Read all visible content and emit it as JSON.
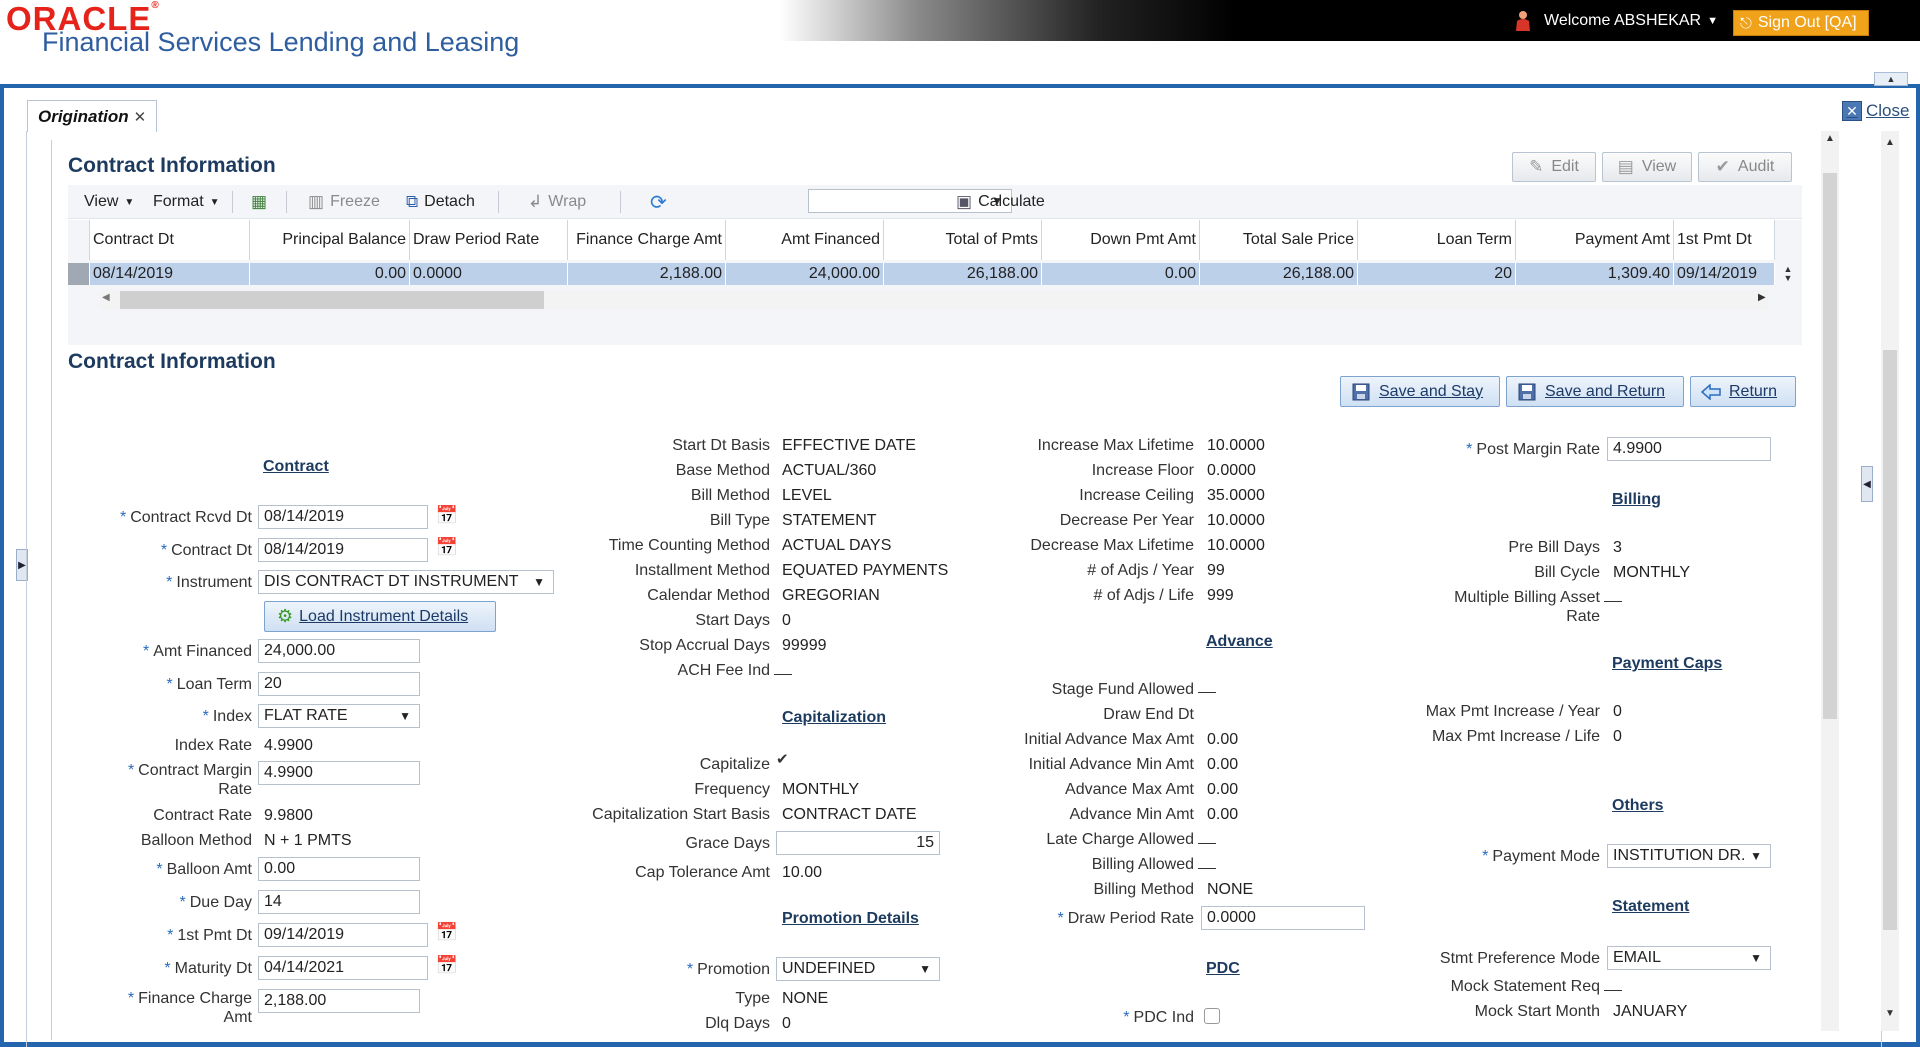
{
  "header": {
    "brand": "ORACLE",
    "product": "Financial Services Lending and Leasing",
    "welcome": "Welcome ABSHEKAR",
    "signout": "Sign Out [QA]"
  },
  "tabs": {
    "origination": "Origination",
    "close_label": "Close"
  },
  "section1": {
    "title": "Contract Information"
  },
  "top_buttons": {
    "edit": "Edit",
    "view": "View",
    "audit": "Audit"
  },
  "grid_toolbar": {
    "view": "View",
    "format": "Format",
    "freeze": "Freeze",
    "detach": "Detach",
    "wrap": "Wrap",
    "calculate": "Calculate"
  },
  "grid": {
    "columns": [
      "Contract Dt",
      "Principal Balance",
      "Draw Period Rate",
      "Finance Charge Amt",
      "Amt Financed",
      "Total of Pmts",
      "Down Pmt Amt",
      "Total Sale Price",
      "Loan Term",
      "Payment Amt",
      "1st Pmt Dt"
    ],
    "row": [
      "08/14/2019",
      "0.00",
      "0.0000",
      "2,188.00",
      "24,000.00",
      "26,188.00",
      "0.00",
      "26,188.00",
      "20",
      "1,309.40",
      "09/14/2019"
    ]
  },
  "section2": {
    "title": "Contract Information"
  },
  "actions": {
    "save_stay": "Save and Stay",
    "save_return": "Save and Return",
    "return": "Return"
  },
  "col1": {
    "group": "Contract",
    "contract_rcvd_dt_label": "Contract Rcvd Dt",
    "contract_rcvd_dt": "08/14/2019",
    "contract_dt_label": "Contract Dt",
    "contract_dt": "08/14/2019",
    "instrument_label": "Instrument",
    "instrument": "DIS CONTRACT DT INSTRUMENT",
    "load_instrument": "Load Instrument Details",
    "amt_financed_label": "Amt Financed",
    "amt_financed": "24,000.00",
    "loan_term_label": "Loan Term",
    "loan_term": "20",
    "index_label": "Index",
    "index": "FLAT RATE",
    "index_rate_label": "Index Rate",
    "index_rate": "4.9900",
    "contract_margin_label1": "Contract Margin",
    "contract_margin_label2": "Rate",
    "contract_margin": "4.9900",
    "contract_rate_label": "Contract Rate",
    "contract_rate": "9.9800",
    "balloon_method_label": "Balloon Method",
    "balloon_method": "N + 1 PMTS",
    "balloon_amt_label": "Balloon Amt",
    "balloon_amt": "0.00",
    "due_day_label": "Due Day",
    "due_day": "14",
    "first_pmt_dt_label": "1st Pmt Dt",
    "first_pmt_dt": "09/14/2019",
    "maturity_dt_label": "Maturity Dt",
    "maturity_dt": "04/14/2021",
    "finance_charge_label1": "Finance Charge",
    "finance_charge_label2": "Amt",
    "finance_charge": "2,188.00"
  },
  "col2": {
    "start_dt_basis_label": "Start Dt Basis",
    "start_dt_basis": "EFFECTIVE DATE",
    "base_method_label": "Base Method",
    "base_method": "ACTUAL/360",
    "bill_method_label": "Bill Method",
    "bill_method": "LEVEL",
    "bill_type_label": "Bill Type",
    "bill_type": "STATEMENT",
    "time_counting_label": "Time Counting Method",
    "time_counting": "ACTUAL DAYS",
    "installment_label": "Installment Method",
    "installment": "EQUATED PAYMENTS",
    "calendar_label": "Calendar Method",
    "calendar": "GREGORIAN",
    "start_days_label": "Start Days",
    "start_days": "0",
    "stop_accrual_label": "Stop Accrual Days",
    "stop_accrual": "99999",
    "ach_fee_label": "ACH Fee Ind",
    "cap_group": "Capitalization",
    "capitalize_label": "Capitalize",
    "frequency_label": "Frequency",
    "frequency": "MONTHLY",
    "cap_start_label": "Capitalization Start Basis",
    "cap_start": "CONTRACT DATE",
    "grace_days_label": "Grace Days",
    "grace_days": "15",
    "cap_tol_label": "Cap Tolerance Amt",
    "cap_tol": "10.00",
    "promo_group": "Promotion Details",
    "promotion_label": "Promotion",
    "promotion": "UNDEFINED",
    "type_label": "Type",
    "type": "NONE",
    "dlq_days_label": "Dlq Days",
    "dlq_days": "0"
  },
  "col3": {
    "inc_max_life_label": "Increase Max Lifetime",
    "inc_max_life": "10.0000",
    "inc_floor_label": "Increase Floor",
    "inc_floor": "0.0000",
    "inc_ceiling_label": "Increase Ceiling",
    "inc_ceiling": "35.0000",
    "dec_per_year_label": "Decrease Per Year",
    "dec_per_year": "10.0000",
    "dec_max_life_label": "Decrease Max Lifetime",
    "dec_max_life": "10.0000",
    "adjs_year_label": "# of Adjs / Year",
    "adjs_year": "99",
    "adjs_life_label": "# of Adjs / Life",
    "adjs_life": "999",
    "adv_group": "Advance",
    "stage_fund_label": "Stage Fund Allowed",
    "draw_end_label": "Draw End Dt",
    "init_adv_max_label": "Initial Advance Max Amt",
    "init_adv_max": "0.00",
    "init_adv_min_label": "Initial Advance Min Amt",
    "init_adv_min": "0.00",
    "adv_max_label": "Advance Max Amt",
    "adv_max": "0.00",
    "adv_min_label": "Advance Min Amt",
    "adv_min": "0.00",
    "late_charge_label": "Late Charge Allowed",
    "billing_allowed_label": "Billing Allowed",
    "billing_method_label": "Billing Method",
    "billing_method": "NONE",
    "draw_period_label": "Draw Period Rate",
    "draw_period": "0.0000",
    "pdc_group": "PDC",
    "pdc_ind_label": "PDC Ind"
  },
  "col4": {
    "post_margin_label": "Post Margin Rate",
    "post_margin": "4.9900",
    "billing_group": "Billing",
    "pre_bill_label": "Pre Bill Days",
    "pre_bill": "3",
    "bill_cycle_label": "Bill Cycle",
    "bill_cycle": "MONTHLY",
    "multi_billing_label1": "Multiple Billing Asset",
    "multi_billing_label2": "Rate",
    "caps_group": "Payment Caps",
    "max_inc_year_label": "Max Pmt Increase / Year",
    "max_inc_year": "0",
    "max_inc_life_label": "Max Pmt Increase / Life",
    "max_inc_life": "0",
    "others_group": "Others",
    "payment_mode_label": "Payment Mode",
    "payment_mode": "INSTITUTION DR.",
    "statement_group": "Statement",
    "stmt_pref_label": "Stmt Preference Mode",
    "stmt_pref": "EMAIL",
    "mock_req_label": "Mock Statement Req",
    "mock_start_label": "Mock Start Month",
    "mock_start": "JANUARY"
  },
  "colors": {
    "brand_red": "#e5231b",
    "product_blue": "#2e5e9e",
    "frame_blue": "#2466ae",
    "signout_orange": "#f0a21b",
    "row_selected": "#bdd0ea"
  }
}
